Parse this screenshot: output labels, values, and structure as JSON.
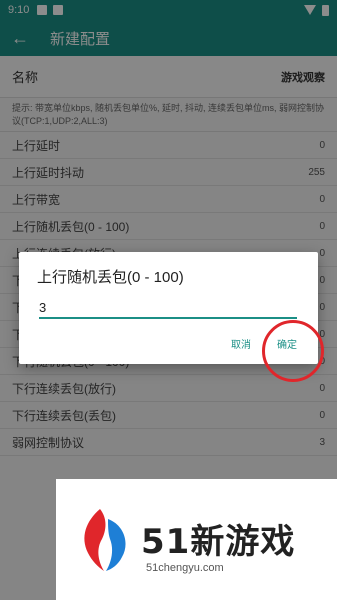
{
  "status_bar": {
    "time": "9:10"
  },
  "app_bar": {
    "title": "新建配置"
  },
  "name": {
    "label": "名称",
    "value": "游戏观察"
  },
  "hint": "提示: 带宽单位kbps, 随机丢包单位%, 延时, 抖动, 连续丢包单位ms, 弱网控制协议(TCP:1,UDP:2,ALL:3)",
  "rows": [
    {
      "label": "上行延时",
      "value": "0"
    },
    {
      "label": "上行延时抖动",
      "value": "255"
    },
    {
      "label": "上行带宽",
      "value": "0"
    },
    {
      "label": "上行随机丢包(0 - 100)",
      "value": "0"
    },
    {
      "label": "上行连续丢包(放行)",
      "value": "0"
    },
    {
      "label": "下",
      "value": "0"
    },
    {
      "label": "下",
      "value": "0"
    },
    {
      "label": "下",
      "value": "0"
    },
    {
      "label": "下行随机丢包(0 - 100)",
      "value": "0"
    },
    {
      "label": "下行连续丢包(放行)",
      "value": "0"
    },
    {
      "label": "下行连续丢包(丢包)",
      "value": "0"
    },
    {
      "label": "弱网控制协议",
      "value": "3"
    }
  ],
  "dialog": {
    "title": "上行随机丢包(0 - 100)",
    "input_value": "3",
    "cancel_label": "取消",
    "confirm_label": "确定"
  },
  "watermark": {
    "brand": "51新游戏",
    "url": "51chengyu.com"
  },
  "colors": {
    "accent": "#1b8f86",
    "annotation": "#e0262b"
  }
}
